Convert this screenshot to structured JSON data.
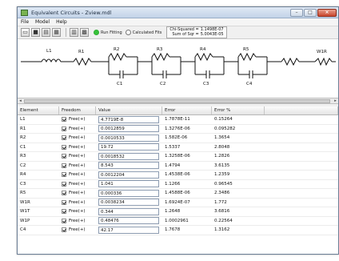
{
  "window": {
    "title": "Equivalent Circuits - Zview.mdl"
  },
  "menu": [
    "File",
    "Model",
    "Help"
  ],
  "toolbar": {
    "radio_run": "Run Fitting",
    "radio_calc": "Calculated Fits",
    "stats_labels": [
      "Chi-Squared =",
      "Sum of Sqr ="
    ],
    "stats_values": [
      "1.1498E-07",
      "5.0043E-05"
    ]
  },
  "circuit": {
    "labels": [
      "L1",
      "R1",
      "R2",
      "R3",
      "R4",
      "R5",
      "W1R",
      "C1",
      "C2",
      "C3",
      "C4"
    ]
  },
  "table": {
    "headers": [
      "Element",
      "Freedom",
      "Value",
      "Error",
      "Error %"
    ],
    "rows": [
      {
        "element": "L1",
        "freedom": "Free(+)",
        "value": "4.7719E-8",
        "error": "1.7878E-11",
        "error_pct": "0.15264"
      },
      {
        "element": "R1",
        "freedom": "Free(+)",
        "value": "0.0012859",
        "error": "1.3276E-06",
        "error_pct": "0.095282"
      },
      {
        "element": "R2",
        "freedom": "Free(+)",
        "value": "0.0010533",
        "error": "1.582E-06",
        "error_pct": "1.3654"
      },
      {
        "element": "C1",
        "freedom": "Free(+)",
        "value": "19.72",
        "error": "1.5337",
        "error_pct": "2.8048"
      },
      {
        "element": "R3",
        "freedom": "Free(+)",
        "value": "0.0018532",
        "error": "1.3258E-06",
        "error_pct": "1.2826"
      },
      {
        "element": "C2",
        "freedom": "Free(+)",
        "value": "8.543",
        "error": "1.4794",
        "error_pct": "3.6135"
      },
      {
        "element": "R4",
        "freedom": "Free(+)",
        "value": "0.0012204",
        "error": "1.4538E-06",
        "error_pct": "1.2359"
      },
      {
        "element": "C3",
        "freedom": "Free(+)",
        "value": "1.041",
        "error": "1.1266",
        "error_pct": "0.96545"
      },
      {
        "element": "R5",
        "freedom": "Free(+)",
        "value": "0.000336",
        "error": "1.4588E-06",
        "error_pct": "2.3486"
      },
      {
        "element": "W1R",
        "freedom": "Free(+)",
        "value": "0.0038234",
        "error": "1.6924E-07",
        "error_pct": "1.772"
      },
      {
        "element": "W1T",
        "freedom": "Free(+)",
        "value": "0.344",
        "error": "1.2648",
        "error_pct": "3.6816"
      },
      {
        "element": "W1P",
        "freedom": "Free(+)",
        "value": "0.48476",
        "error": "1.0002961",
        "error_pct": "0.22564"
      },
      {
        "element": "C4",
        "freedom": "Free(+)",
        "value": "42.17",
        "error": "1.7678",
        "error_pct": "1.3162"
      }
    ]
  }
}
